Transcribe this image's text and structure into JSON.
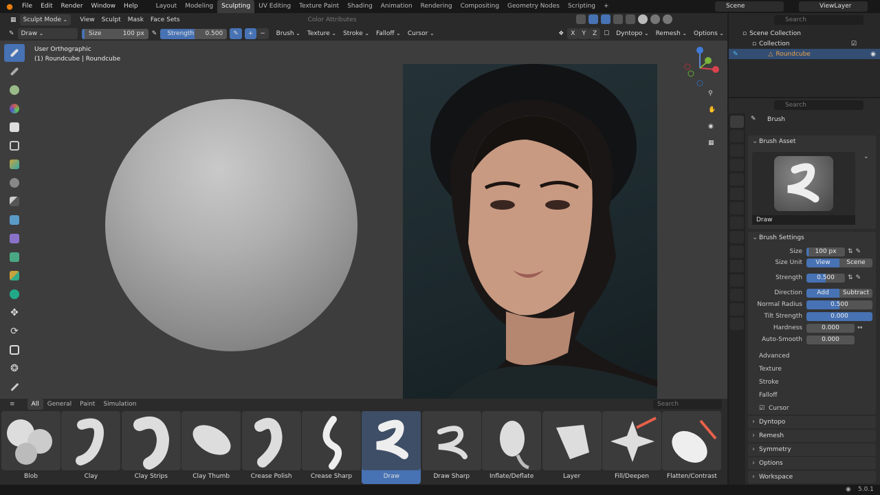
{
  "topbar": {
    "menus": [
      "File",
      "Edit",
      "Render",
      "Window",
      "Help"
    ],
    "workspaces": [
      "Layout",
      "Modeling",
      "Sculpting",
      "UV Editing",
      "Texture Paint",
      "Shading",
      "Animation",
      "Rendering",
      "Compositing",
      "Geometry Nodes",
      "Scripting"
    ],
    "active_workspace": "Sculpting",
    "scene": "Scene",
    "view_layer": "ViewLayer"
  },
  "header": {
    "mode": "Sculpt Mode",
    "menus": [
      "View",
      "Sculpt",
      "Mask",
      "Face Sets"
    ],
    "color_attributes": "Color Attributes",
    "brush_name": "Draw",
    "size_label": "Size",
    "size_value": "100 px",
    "strength_label": "Strength",
    "strength_value": "0.500",
    "dropdowns": [
      "Brush",
      "Texture",
      "Stroke",
      "Falloff",
      "Cursor"
    ],
    "axes": [
      "X",
      "Y",
      "Z"
    ],
    "dyntopo": "Dyntopo",
    "remesh": "Remesh",
    "options": "Options"
  },
  "viewport": {
    "view_name": "User Orthographic",
    "object_info": "(1) Roundcube | Roundcube"
  },
  "shelf": {
    "tabs": [
      "All",
      "General",
      "Paint",
      "Simulation"
    ],
    "search_placeholder": "Search",
    "brushes": [
      "Blob",
      "Clay",
      "Clay Strips",
      "Clay Thumb",
      "Crease Polish",
      "Crease Sharp",
      "Draw",
      "Draw Sharp",
      "Inflate/Deflate",
      "Layer",
      "Fill/Deepen",
      "Flatten/Contrast"
    ],
    "active_brush": "Draw"
  },
  "outliner": {
    "search_placeholder": "Search",
    "scene_collection": "Scene Collection",
    "collection": "Collection",
    "object": "Roundcube"
  },
  "properties": {
    "search_placeholder": "Search",
    "title": "Brush",
    "brush_asset": "Brush Asset",
    "asset_name": "Draw",
    "brush_settings": "Brush Settings",
    "size_label": "Size",
    "size_value": "100 px",
    "size_unit_label": "Size Unit",
    "size_unit_view": "View",
    "size_unit_scene": "Scene",
    "strength_label": "Strength",
    "strength_value": "0.500",
    "direction_label": "Direction",
    "direction_add": "Add",
    "direction_subtract": "Subtract",
    "normal_radius_label": "Normal Radius",
    "normal_radius_value": "0.500",
    "tilt_strength_label": "Tilt Strength",
    "tilt_strength_value": "0.000",
    "hardness_label": "Hardness",
    "hardness_value": "0.000",
    "auto_smooth_label": "Auto-Smooth",
    "auto_smooth_value": "0.000",
    "subpanels": [
      "Advanced",
      "Texture",
      "Stroke",
      "Falloff",
      "Cursor"
    ],
    "panels": [
      "Dyntopo",
      "Remesh",
      "Symmetry",
      "Options",
      "Workspace"
    ]
  },
  "status": {
    "version": "5.0.1"
  },
  "colors": {
    "accent": "#4772b3",
    "background": "#3d3d3d",
    "logo": "#e87d0d"
  }
}
